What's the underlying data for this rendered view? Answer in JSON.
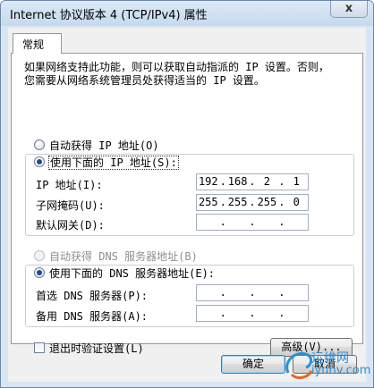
{
  "window": {
    "title": "Internet 协议版本 4 (TCP/IPv4) 属性",
    "close_glyph": "x"
  },
  "tabs": [
    {
      "label": "常规",
      "selected": true
    }
  ],
  "description": {
    "line1": "如果网络支持此功能，则可以获取自动指派的 IP 设置。否则，",
    "line2": "您需要从网络系统管理员处获得适当的 IP 设置。"
  },
  "ip_section": {
    "auto_label": "自动获得 IP 地址(O)",
    "manual_label": "使用下面的 IP 地址(S):",
    "selected": "manual",
    "fields": [
      {
        "label": "IP 地址(I):",
        "octets": [
          "192",
          "168",
          "2",
          "1"
        ]
      },
      {
        "label": "子网掩码(U):",
        "octets": [
          "255",
          "255",
          "255",
          "0"
        ]
      },
      {
        "label": "默认网关(D):",
        "octets": [
          "",
          "",
          "",
          ""
        ]
      }
    ]
  },
  "dns_section": {
    "auto_label": "自动获得 DNS 服务器地址(B)",
    "manual_label": "使用下面的 DNS 服务器地址(E):",
    "selected": "manual",
    "auto_disabled": true,
    "fields": [
      {
        "label": "首选 DNS 服务器(P):",
        "octets": [
          "",
          "",
          "",
          ""
        ]
      },
      {
        "label": "备用 DNS 服务器(A):",
        "octets": [
          "",
          "",
          "",
          ""
        ]
      }
    ]
  },
  "validate_on_exit": {
    "label": "退出时验证设置(L)",
    "checked": false
  },
  "buttons": {
    "advanced": "高级(V)...",
    "ok": "确定",
    "cancel": "取消"
  },
  "watermark": {
    "line1": "运维网",
    "line2": "iyunv.com"
  }
}
